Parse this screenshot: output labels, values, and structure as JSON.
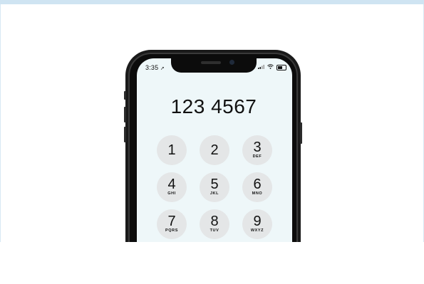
{
  "status_bar": {
    "time": "3:35",
    "location_icon": "location-arrow-icon",
    "signal_icon": "cell-signal-icon",
    "wifi_icon": "wifi-icon",
    "battery_icon": "battery-icon"
  },
  "dialer": {
    "number": "123 4567",
    "keys": [
      {
        "digit": "1",
        "letters": ""
      },
      {
        "digit": "2",
        "letters": ""
      },
      {
        "digit": "3",
        "letters": "DEF"
      },
      {
        "digit": "4",
        "letters": "GHI"
      },
      {
        "digit": "5",
        "letters": "JKL"
      },
      {
        "digit": "6",
        "letters": "MNO"
      },
      {
        "digit": "7",
        "letters": "PQRS"
      },
      {
        "digit": "8",
        "letters": "TUV"
      },
      {
        "digit": "9",
        "letters": "WXYZ"
      }
    ]
  },
  "colors": {
    "screen_bg": "#eef7f9",
    "key_bg": "#e4e6e7",
    "frame": "#1a1a1a",
    "top_strip": "#cfe4f2"
  }
}
